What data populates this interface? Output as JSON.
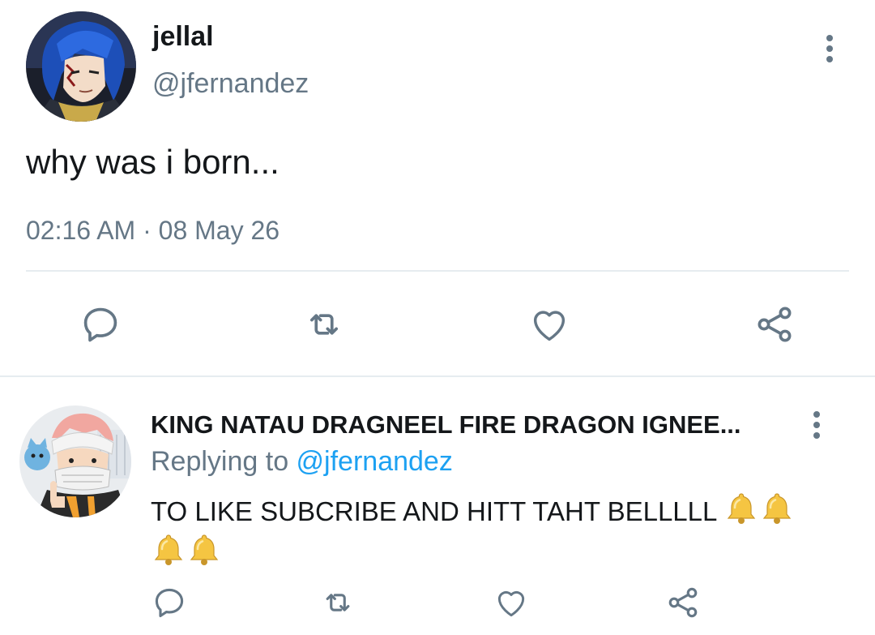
{
  "tweet": {
    "display_name": "jellal",
    "handle": "@jfernandez",
    "text": "why was i born...",
    "time": "02:16 AM",
    "separator": "·",
    "date": "08 May 26"
  },
  "reply": {
    "display_name": "KING NATAU DRAGNEEL FIRE DRAGON IGNEE...",
    "replying_prefix": "Replying to ",
    "replying_handle": "@jfernandez",
    "text": "TO LIKE SUBCRIBE AND HITT TAHT BELLLLL"
  },
  "icons": {
    "reply": "speech-bubble-icon",
    "retweet": "retweet-icon",
    "like": "heart-icon",
    "share": "share-icon",
    "more": "more-vertical-icon",
    "bell": "bell-emoji"
  },
  "colors": {
    "text_primary": "#14171a",
    "text_secondary": "#657786",
    "link": "#1da1f2",
    "divider": "#e6ecf0"
  }
}
